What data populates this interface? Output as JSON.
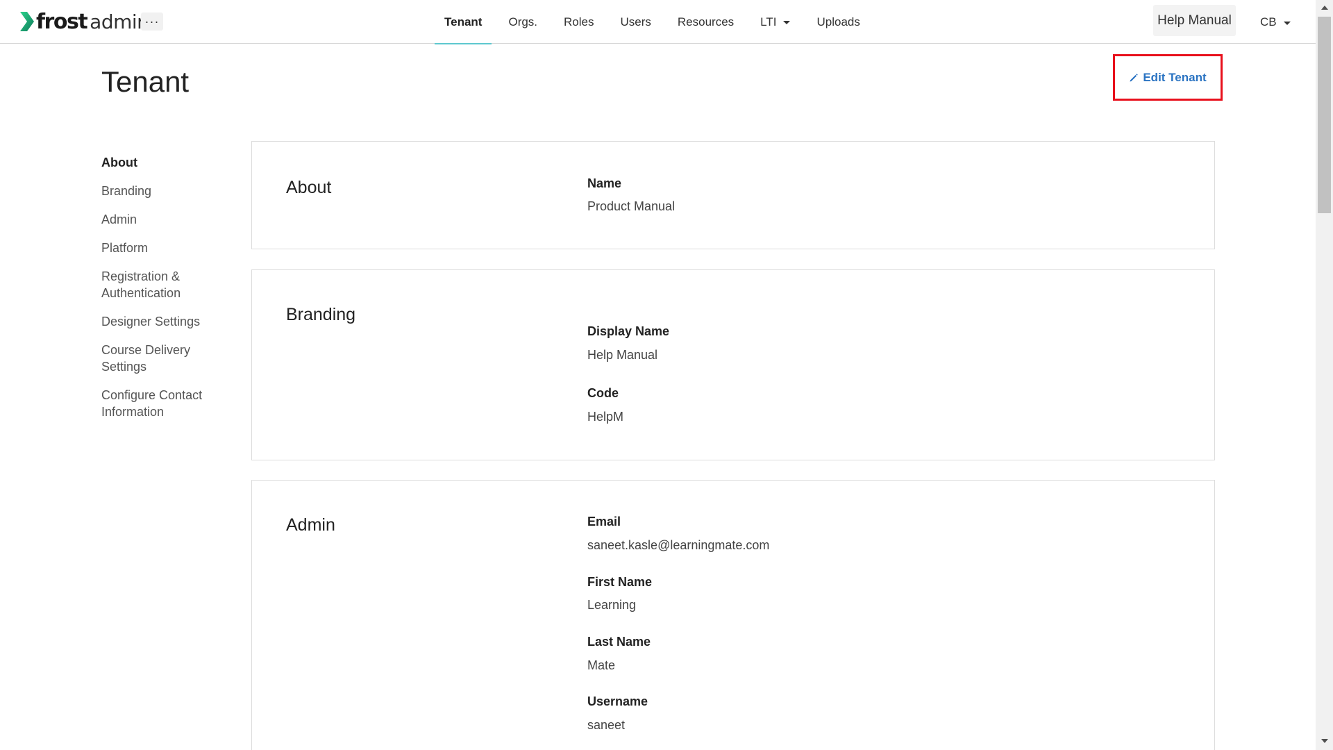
{
  "app": {
    "logo_frost": "frost",
    "logo_admin": "admin",
    "more_label": "···"
  },
  "nav": {
    "items": [
      {
        "label": "Tenant"
      },
      {
        "label": "Orgs."
      },
      {
        "label": "Roles"
      },
      {
        "label": "Users"
      },
      {
        "label": "Resources"
      },
      {
        "label": "LTI"
      },
      {
        "label": "Uploads"
      }
    ],
    "active": "Tenant",
    "help_label": "Help Manual",
    "user_initials": "CB"
  },
  "page": {
    "title": "Tenant",
    "edit_label": "Edit Tenant"
  },
  "sidenav": {
    "items": [
      {
        "label": "About"
      },
      {
        "label": "Branding"
      },
      {
        "label": "Admin"
      },
      {
        "label": "Platform"
      },
      {
        "label": "Registration & Authentication"
      },
      {
        "label": "Designer Settings"
      },
      {
        "label": "Course Delivery Settings"
      },
      {
        "label": "Configure Contact Information"
      }
    ],
    "active": "About"
  },
  "sections": {
    "about": {
      "title": "About",
      "fields": [
        {
          "label": "Name",
          "value": "Product Manual"
        }
      ]
    },
    "branding": {
      "title": "Branding",
      "fields": [
        {
          "label": "Display Name",
          "value": "Help Manual"
        },
        {
          "label": "Code",
          "value": "HelpM"
        }
      ]
    },
    "admin": {
      "title": "Admin",
      "fields": [
        {
          "label": "Email",
          "value": "saneet.kasle@learningmate.com"
        },
        {
          "label": "First Name",
          "value": "Learning"
        },
        {
          "label": "Last Name",
          "value": "Mate"
        },
        {
          "label": "Username",
          "value": "saneet"
        }
      ]
    }
  },
  "colors": {
    "accent": "#5ec8cf",
    "link": "#2a73c2",
    "highlight_box": "#e8101c",
    "logo_green": "#1fa86b"
  },
  "icons": {
    "logo": "frost-chevron-logo",
    "edit": "pencil-icon",
    "lti_dropdown": "caret-down-icon"
  }
}
